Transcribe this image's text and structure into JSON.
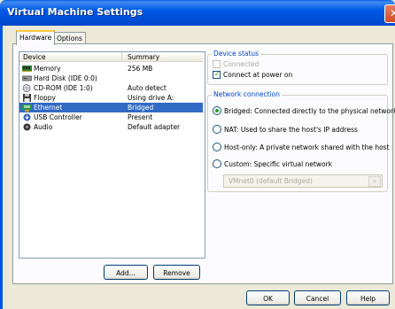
{
  "window": {
    "title": "Virtual Machine Settings"
  },
  "tabs": [
    {
      "label": "Hardware",
      "active": true
    },
    {
      "label": "Options",
      "active": false
    }
  ],
  "device_list": {
    "columns": [
      "Device",
      "Summary"
    ],
    "rows": [
      {
        "device": "Memory",
        "summary": "256 MB",
        "icon": "memory-icon"
      },
      {
        "device": "Hard Disk (IDE 0:0)",
        "summary": "",
        "icon": "hard-disk-icon"
      },
      {
        "device": "CD-ROM (IDE 1:0)",
        "summary": "Auto detect",
        "icon": "cdrom-icon"
      },
      {
        "device": "Floppy",
        "summary": "Using drive A:",
        "icon": "floppy-icon"
      },
      {
        "device": "Ethernet",
        "summary": "Bridged",
        "icon": "ethernet-icon",
        "selected": true
      },
      {
        "device": "USB Controller",
        "summary": "Present",
        "icon": "usb-icon"
      },
      {
        "device": "Audio",
        "summary": "Default adapter",
        "icon": "audio-icon"
      }
    ]
  },
  "list_buttons": {
    "add": "Add...",
    "remove": "Remove"
  },
  "device_status": {
    "heading": "Device status",
    "connected": {
      "label": "Connected",
      "checked": false,
      "enabled": false
    },
    "connect_at_power_on": {
      "label": "Connect at power on",
      "checked": true
    }
  },
  "network_connection": {
    "heading": "Network connection",
    "options": [
      {
        "label": "Bridged: Connected directly to the physical network",
        "checked": true
      },
      {
        "label": "NAT: Used to share the host's IP address",
        "checked": false
      },
      {
        "label": "Host-only: A private network shared with the host",
        "checked": false
      },
      {
        "label": "Custom: Specific virtual network",
        "checked": false
      }
    ],
    "custom_select_value": "VMnet0 (default Bridged)"
  },
  "footer_buttons": {
    "ok": "OK",
    "cancel": "Cancel",
    "help": "Help"
  },
  "colors": {
    "selection": "#316AC5",
    "titlebar": "#0054E3",
    "group_heading": "#0046D5"
  }
}
